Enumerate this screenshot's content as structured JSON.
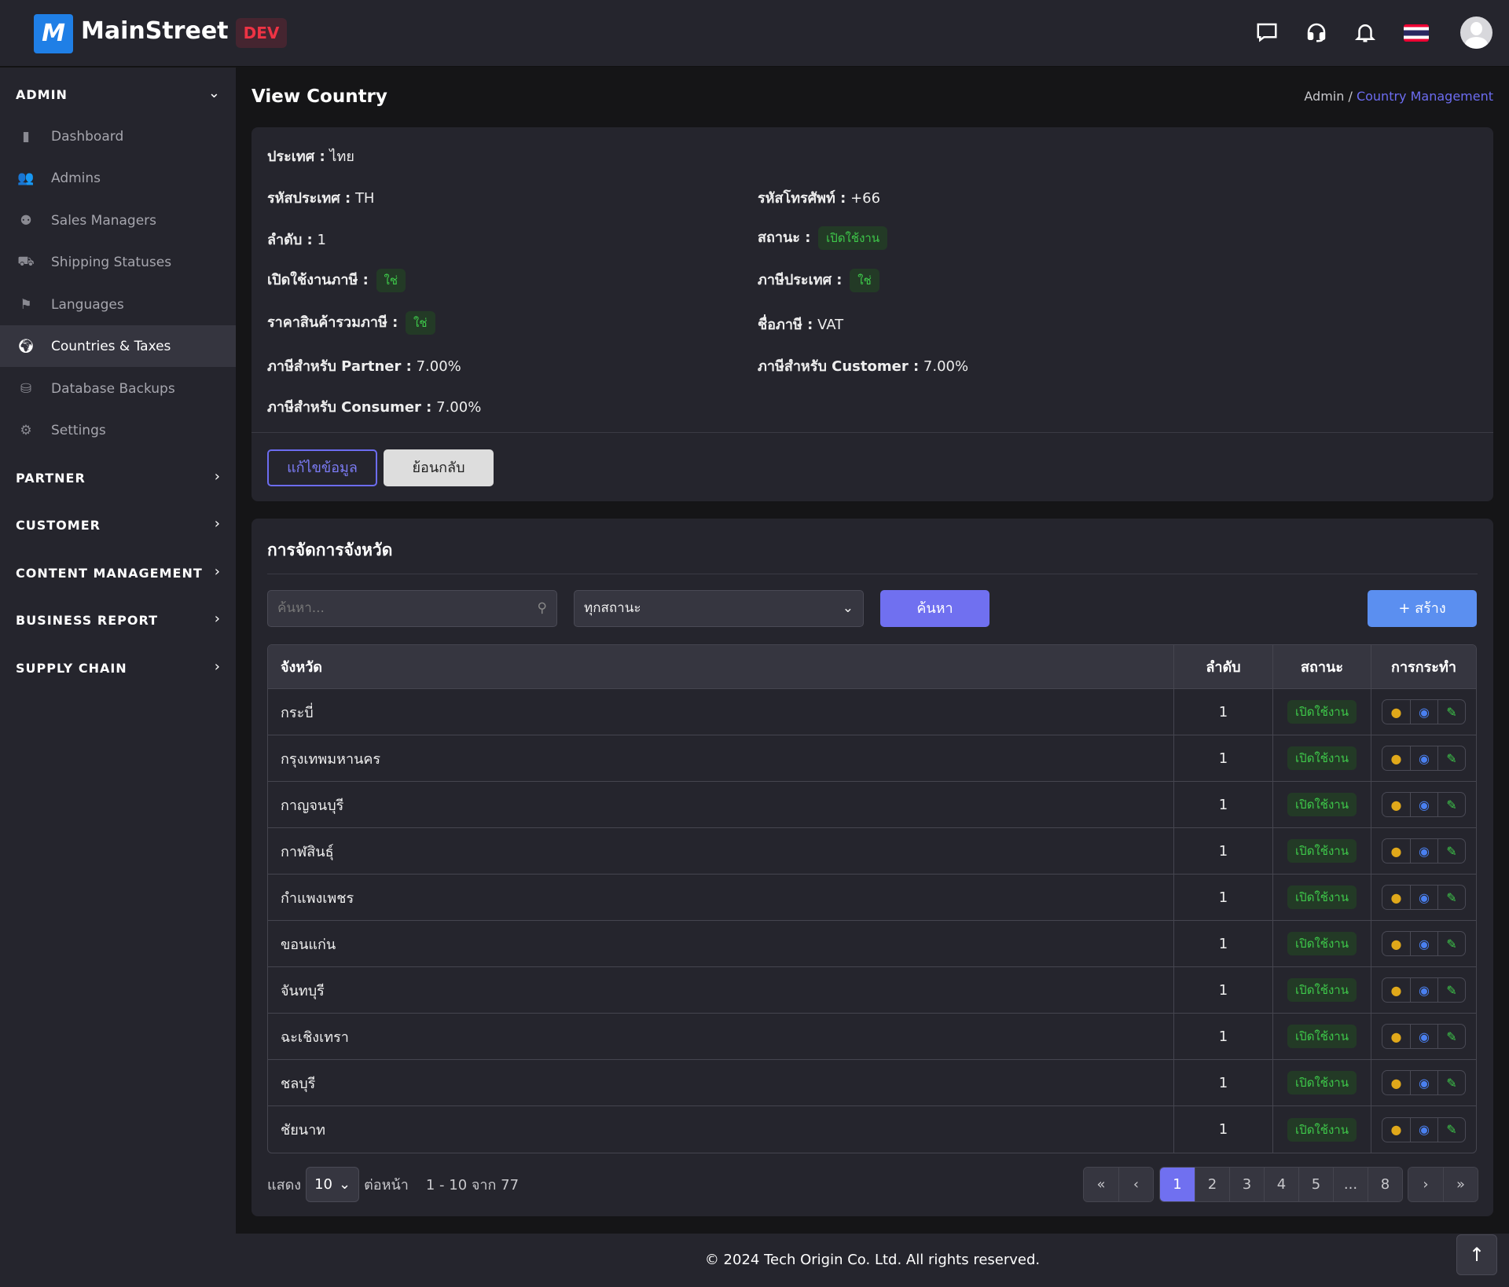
{
  "header": {
    "brand": "MainStreet",
    "logo_letter": "M",
    "env_badge": "DEV",
    "icons": [
      "chat-icon",
      "headset-icon",
      "bell-icon",
      "thai-flag-icon",
      "avatar"
    ]
  },
  "sidebar": {
    "admin": {
      "label": "ADMIN",
      "items": [
        {
          "label": "Dashboard",
          "icon": "chart-bar-icon"
        },
        {
          "label": "Admins",
          "icon": "users-icon"
        },
        {
          "label": "Sales Managers",
          "icon": "people-group-icon"
        },
        {
          "label": "Shipping Statuses",
          "icon": "dolly-icon"
        },
        {
          "label": "Languages",
          "icon": "flag-icon"
        },
        {
          "label": "Countries & Taxes",
          "icon": "globe-icon",
          "active": true
        },
        {
          "label": "Database Backups",
          "icon": "database-icon"
        },
        {
          "label": "Settings",
          "icon": "gear-icon"
        }
      ]
    },
    "sections": [
      "PARTNER",
      "CUSTOMER",
      "CONTENT MANAGEMENT",
      "BUSINESS REPORT",
      "SUPPLY CHAIN"
    ]
  },
  "page": {
    "title": "View Country",
    "breadcrumb": {
      "root": "Admin",
      "sep": " / ",
      "current": "Country Management"
    }
  },
  "country": {
    "name": {
      "label": "ประเทศ :",
      "value": "ไทย"
    },
    "code": {
      "label": "รหัสประเทศ :",
      "value": "TH"
    },
    "phone": {
      "label": "รหัสโทรศัพท์ :",
      "value": "+66"
    },
    "order": {
      "label": "ลำดับ :",
      "value": "1"
    },
    "status": {
      "label": "สถานะ :",
      "value": "เปิดใช้งาน"
    },
    "tax_enabled": {
      "label": "เปิดใช้งานภาษี :",
      "value": "ใช่"
    },
    "country_tax": {
      "label": "ภาษีประเทศ :",
      "value": "ใช่"
    },
    "price_incl_tax": {
      "label": "ราคาสินค้ารวมภาษี :",
      "value": "ใช่"
    },
    "tax_name": {
      "label": "ชื่อภาษี :",
      "value": "VAT"
    },
    "tax_partner": {
      "label": "ภาษีสำหรับ Partner :",
      "value": "7.00%"
    },
    "tax_customer": {
      "label": "ภาษีสำหรับ Customer :",
      "value": "7.00%"
    },
    "tax_consumer": {
      "label": "ภาษีสำหรับ Consumer :",
      "value": "7.00%"
    },
    "edit_label": "แก้ไขข้อมูล",
    "back_label": "ย้อนกลับ"
  },
  "provinces": {
    "title": "การจัดการจังหวัด",
    "search_placeholder": "ค้นหา...",
    "status_filter": "ทุกสถานะ",
    "search_button": "ค้นหา",
    "create_button": "+ สร้าง",
    "columns": [
      "จังหวัด",
      "ลำดับ",
      "สถานะ",
      "การกระทำ"
    ],
    "rows": [
      {
        "name": "กระบี่",
        "order": "1",
        "status": "เปิดใช้งาน"
      },
      {
        "name": "กรุงเทพมหานคร",
        "order": "1",
        "status": "เปิดใช้งาน"
      },
      {
        "name": "กาญจนบุรี",
        "order": "1",
        "status": "เปิดใช้งาน"
      },
      {
        "name": "กาฬสินธุ์",
        "order": "1",
        "status": "เปิดใช้งาน"
      },
      {
        "name": "กำแพงเพชร",
        "order": "1",
        "status": "เปิดใช้งาน"
      },
      {
        "name": "ขอนแก่น",
        "order": "1",
        "status": "เปิดใช้งาน"
      },
      {
        "name": "จันทบุรี",
        "order": "1",
        "status": "เปิดใช้งาน"
      },
      {
        "name": "ฉะเชิงเทรา",
        "order": "1",
        "status": "เปิดใช้งาน"
      },
      {
        "name": "ชลบุรี",
        "order": "1",
        "status": "เปิดใช้งาน"
      },
      {
        "name": "ชัยนาท",
        "order": "1",
        "status": "เปิดใช้งาน"
      }
    ],
    "pagination": {
      "show_label": "แสดง",
      "per_page": "10",
      "per_page_label": "ต่อหน้า",
      "range": "1 - 10 จาก 77",
      "pages": [
        "1",
        "2",
        "3",
        "4",
        "5",
        "...",
        "8"
      ],
      "current": "1",
      "first": "«",
      "prev": "‹",
      "next": "›",
      "last": "»"
    }
  },
  "footer": {
    "text": "© 2024 Tech Origin Co. Ltd. All rights reserved.",
    "to_top": "↑"
  },
  "colors": {
    "accent": "#7070f0",
    "create": "#5b8ff0",
    "success": "#3ec84a",
    "dev": "#ee3344"
  }
}
